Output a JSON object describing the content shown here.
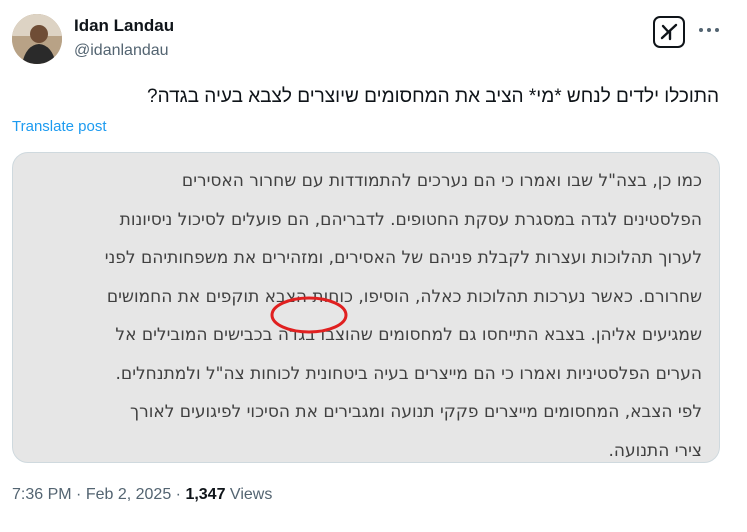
{
  "author": {
    "name": "Idan Landau",
    "handle": "@idanlandau"
  },
  "post": {
    "text": "התוכלו ילדים לנחש *מי* הציב את המחסומים שיוצרים לצבא בעיה בגדה?",
    "translate_label": "Translate post"
  },
  "media": {
    "lines": [
      "כמו כן, בצה\"ל שבו ואמרו כי הם נערכים להתמודדות עם שחרור האסירים",
      "הפלסטינים לגדה במסגרת עסקת החטופים. לדבריהם, הם פועלים לסיכול ניסיונות",
      "לערוך תהלוכות ועצרות לקבלת פניהם של האסירים, ומזהירים את משפחותיהם לפני",
      "שחרורם. כאשר נערכות תהלוכות כאלה, הוסיפו, כוחות הצבא תוקפים את החמושים",
      "שמגיעים אליהן. בצבא התייחסו גם למחסומים שהוצבו בגדה בכבישים המובילים אל",
      "הערים הפלסטיניות ואמרו כי הם מייצרים בעיה ביטחונית לכוחות צה\"ל ולמתנחלים.",
      "לפי הצבא, המחסומים מייצרים פקקי תנועה ומגבירים את הסיכוי לפיגועים לאורך",
      "צירי התנועה."
    ]
  },
  "meta": {
    "time": "7:36 PM",
    "separator1": " · ",
    "date": "Feb 2, 2025",
    "separator2": " · ",
    "views_count": "1,347",
    "views_label": " Views"
  },
  "colors": {
    "link": "#1d9bf0",
    "secondary": "#536471",
    "text": "#0f1419",
    "media_bg": "#e6e6e6",
    "annotation": "#e02020"
  },
  "icons": [
    "grok-icon",
    "more-icon"
  ]
}
